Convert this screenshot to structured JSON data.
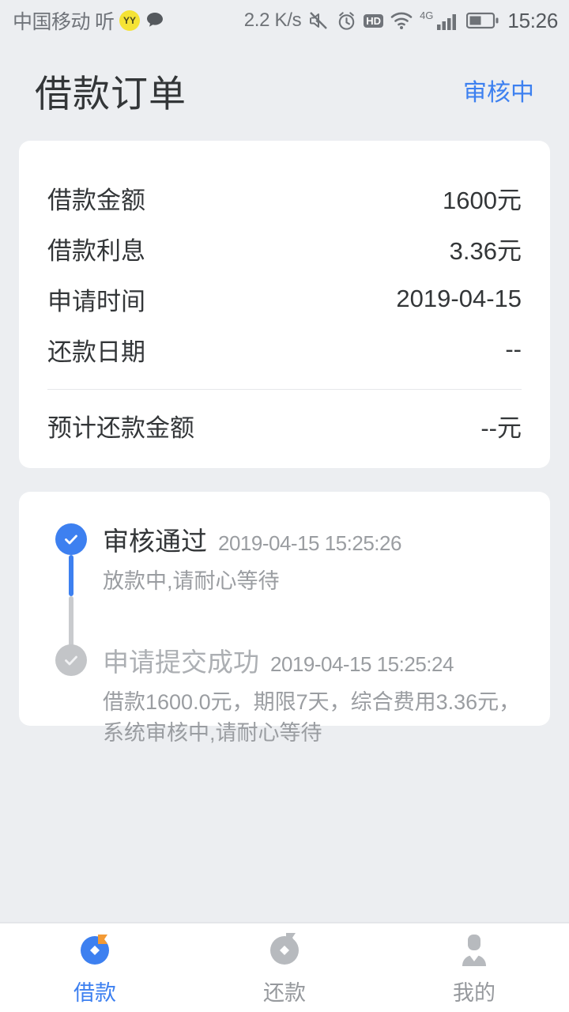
{
  "statusbar": {
    "carrier": "中国移动",
    "ting": "听",
    "yy_badge": "YY",
    "chat_icon": "speech-bubble-icon",
    "network_speed": "2.2 K/s",
    "mute_icon": "mute-icon",
    "alarm_icon": "alarm-clock-icon",
    "hd_label": "HD",
    "wifi_icon": "wifi-icon",
    "signal_label": "4G",
    "signal_icon": "signal-bars-icon",
    "battery_icon": "battery-icon",
    "time": "15:26"
  },
  "header": {
    "title": "借款订单",
    "status": "审核中",
    "status_color": "#3D80F0"
  },
  "detail": {
    "rows": [
      {
        "label": "借款金额",
        "value": "1600元"
      },
      {
        "label": "借款利息",
        "value": "3.36元"
      },
      {
        "label": "申请时间",
        "value": "2019-04-15"
      },
      {
        "label": "还款日期",
        "value": "--"
      }
    ],
    "total": {
      "label": "预计还款金额",
      "value": "--元"
    }
  },
  "timeline": {
    "items": [
      {
        "title": "审核通过",
        "time": "2019-04-15 15:25:26",
        "desc": "放款中,请耐心等待",
        "state": "active"
      },
      {
        "title": "申请提交成功",
        "time": "2019-04-15 15:25:24",
        "desc": "借款1600.0元，期限7天，综合费用3.36元，系统审核中,请耐心等待",
        "state": "done"
      }
    ]
  },
  "tabbar": {
    "tabs": [
      {
        "label": "借款",
        "icon": "loan-icon",
        "active": true
      },
      {
        "label": "还款",
        "icon": "repay-icon",
        "active": false
      },
      {
        "label": "我的",
        "icon": "user-profile-icon",
        "active": false
      }
    ],
    "active_color": "#3D80F0",
    "inactive_color": "#96999D"
  }
}
